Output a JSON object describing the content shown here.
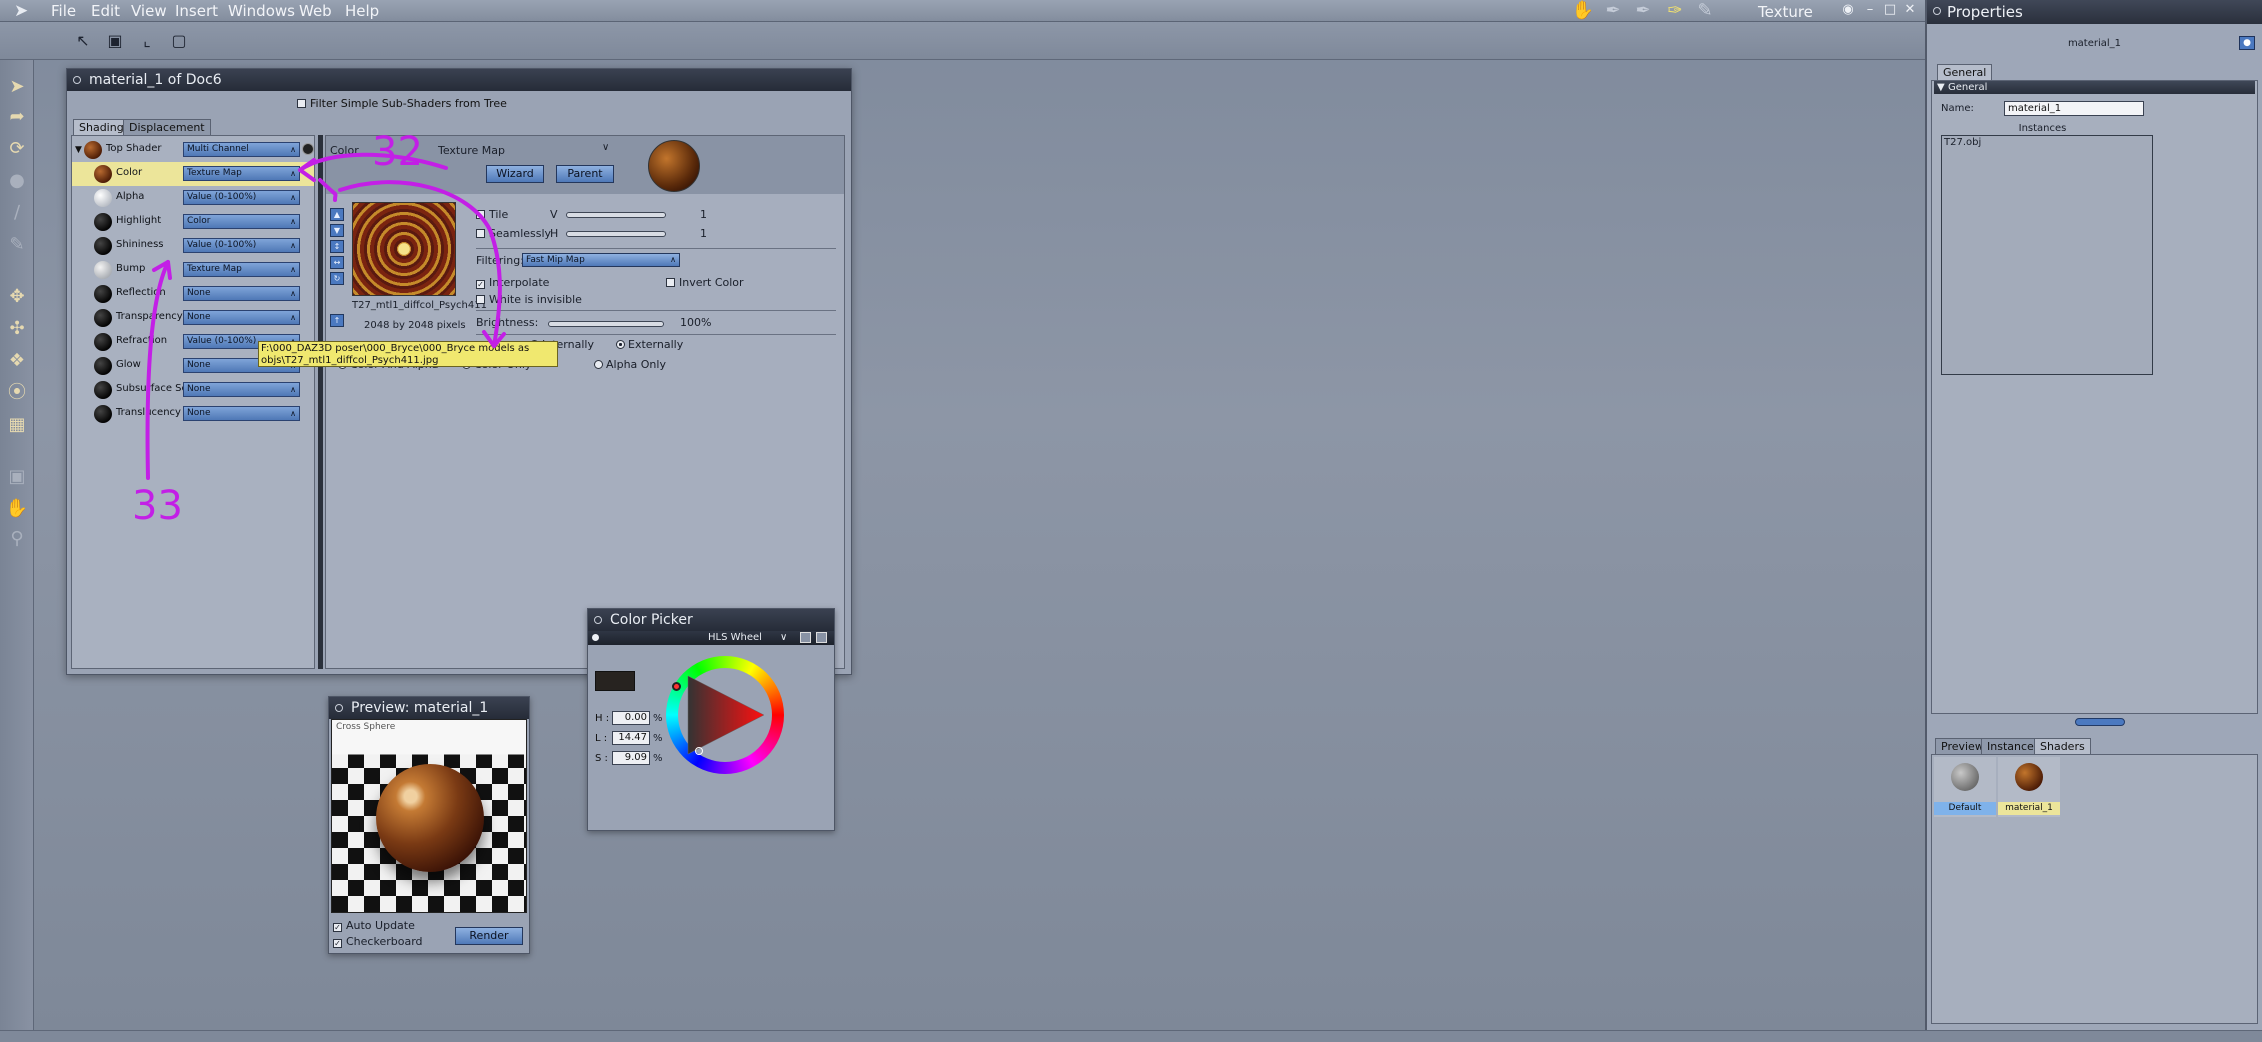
{
  "menubar": {
    "items": [
      "File",
      "Edit",
      "View",
      "Insert",
      "Windows",
      "Web",
      "Help"
    ],
    "room_label": "Texture",
    "room_icons": [
      "hand-icon",
      "pen-icon",
      "pen-icon",
      "brush-icon",
      "eraser-icon"
    ]
  },
  "toolbar": {
    "icons": [
      "arrow-select-icon",
      "scale-box-icon",
      "corner-box-icon",
      "bounding-box-icon"
    ]
  },
  "left_tools": [
    "select-arrow-icon",
    "rotate-view-icon",
    "orbit-icon",
    "sphere-icon",
    "knife-icon",
    "pen-icon",
    "move-icon",
    "move-all-icon",
    "scale-icon",
    "target-icon",
    "shader-icon",
    "camera-icon",
    "hand-icon",
    "zoom-icon"
  ],
  "material_window": {
    "title": "material_1 of Doc6",
    "filter_label": "Filter Simple Sub-Shaders from Tree",
    "tabs": [
      "Shading",
      "Displacement"
    ],
    "tree": [
      {
        "label": "Top Shader",
        "value": "Multi Channel",
        "ball": "tex"
      },
      {
        "label": "Color",
        "value": "Texture Map",
        "ball": "tex"
      },
      {
        "label": "Alpha",
        "value": "Value (0-100%)",
        "ball": "white"
      },
      {
        "label": "Highlight",
        "value": "Color",
        "ball": "black"
      },
      {
        "label": "Shininess",
        "value": "Value (0-100%)",
        "ball": "black"
      },
      {
        "label": "Bump",
        "value": "Texture Map",
        "ball": "bump"
      },
      {
        "label": "Reflection",
        "value": "None",
        "ball": "black"
      },
      {
        "label": "Transparency",
        "value": "None",
        "ball": "black"
      },
      {
        "label": "Refraction",
        "value": "Value (0-100%)",
        "ball": "black"
      },
      {
        "label": "Glow",
        "value": "None",
        "ball": "black"
      },
      {
        "label": "Subsurface Sc",
        "value": "None",
        "ball": "black"
      },
      {
        "label": "Translucency",
        "value": "None",
        "ball": "black"
      }
    ],
    "props": {
      "channel": "Color",
      "type": "Texture Map",
      "wizard_label": "Wizard",
      "parent_label": "Parent",
      "tile_label": "Tile",
      "seamlessly_label": "Seamlessly",
      "v_label": "V",
      "h_label": "H",
      "v_value": "1",
      "h_value": "1",
      "filtering_label": "Filtering:",
      "filtering_value": "Fast Mip Map",
      "interpolate_label": "Interpolate",
      "invert_label": "Invert Color",
      "white_invisible_label": "White is invisible",
      "brightness_label": "Brightness:",
      "brightness_value": "100%",
      "internally_label": "Internally",
      "externally_label": "Externally",
      "color_alpha_label": "Color And Alpha",
      "color_only_label": "Color Only",
      "alpha_only_label": "Alpha Only",
      "texture_name": "T27_mtl1_diffcol_Psych411",
      "texture_size": "2048 by 2048 pixels"
    },
    "tooltip": "F:\\000_DAZ3D poser\\000_Bryce\\000_Bryce models as objs\\T27_mtl1_diffcol_Psych411.jpg"
  },
  "color_picker": {
    "title": "Color Picker",
    "mode": "HLS Wheel",
    "h_label": "H :",
    "l_label": "L :",
    "s_label": "S :",
    "h_value": "0.00",
    "l_value": "14.47",
    "s_value": "9.09",
    "unit": "%",
    "swatch_color": "#272320"
  },
  "preview": {
    "title": "Preview: material_1",
    "overlay_text": "Cross Sphere",
    "auto_update_label": "Auto Update",
    "checkerboard_label": "Checkerboard",
    "render_label": "Render"
  },
  "properties": {
    "title": "Properties",
    "material_name": "material_1",
    "tab": "General",
    "section": "General",
    "name_label": "Name:",
    "name_value": "material_1",
    "instances_label": "Instances",
    "instance_items": [
      "T27.obj"
    ],
    "bottom_tabs": [
      "Preview",
      "Instances",
      "Shaders"
    ],
    "shaders": [
      {
        "label": "Default"
      },
      {
        "label": "material_1"
      }
    ]
  },
  "annotations": {
    "n32": "32",
    "n33": "33",
    "color": "#c31fe6"
  }
}
